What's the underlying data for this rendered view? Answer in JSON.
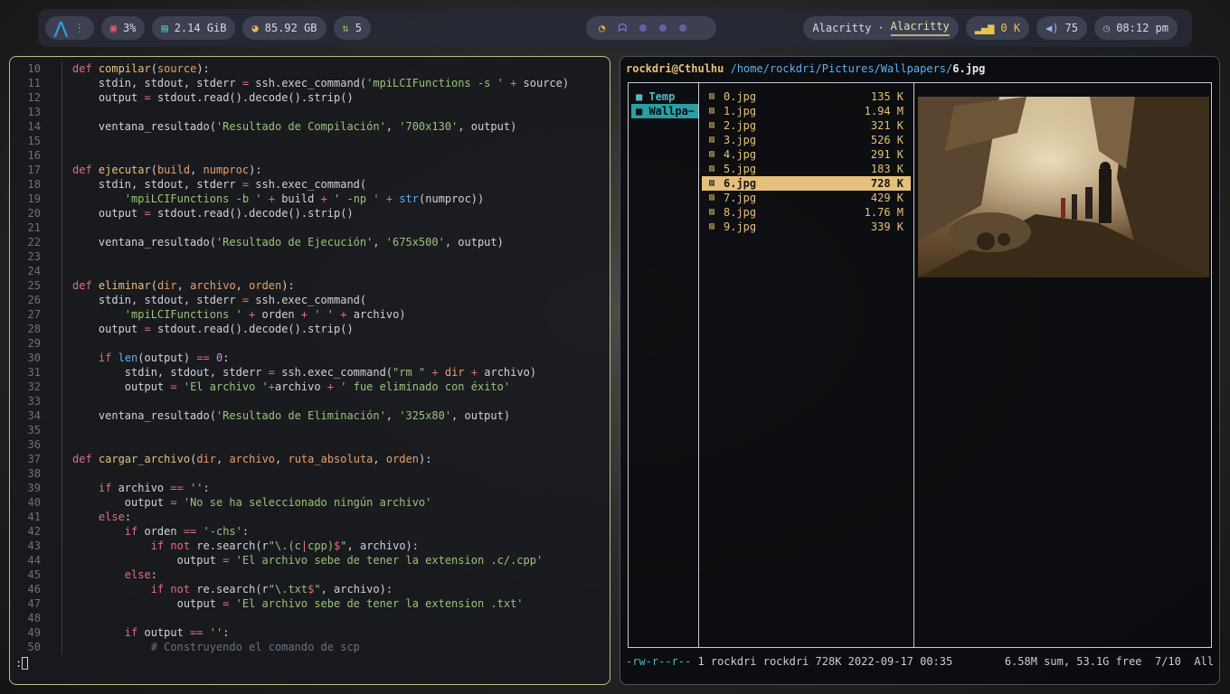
{
  "bar": {
    "cpu": "3%",
    "ram": "2.14 GiB",
    "disk": "85.92 GB",
    "updates": "5",
    "window_title_left": "Alacritty",
    "window_title_sep": "·",
    "window_title_right": "Alacritty",
    "net": "0 K",
    "volume": "75",
    "clock": "08:12 pm",
    "accent": "#2e9bd6"
  },
  "editor": {
    "lines": [
      {
        "n": "10",
        "h": "<span class=\"kw\">def</span> <span class=\"fn\">compilar</span>(<span class=\"prm\">source</span>):"
      },
      {
        "n": "11",
        "h": "    stdin, stdout, stderr <span class=\"op\">=</span> ssh.exec_command(<span class=\"str\">'mpiLCIFunctions -s '</span> <span class=\"op\">+</span> source)"
      },
      {
        "n": "12",
        "h": "    output <span class=\"op\">=</span> stdout.read().decode().strip()"
      },
      {
        "n": "13",
        "h": ""
      },
      {
        "n": "14",
        "h": "    ventana_resultado(<span class=\"str\">'Resultado de Compilación'</span>, <span class=\"str\">'700x130'</span>, output)"
      },
      {
        "n": "15",
        "h": ""
      },
      {
        "n": "16",
        "h": ""
      },
      {
        "n": "17",
        "h": "<span class=\"kw\">def</span> <span class=\"fn\">ejecutar</span>(<span class=\"prm\">build</span>, <span class=\"prm\">numproc</span>):"
      },
      {
        "n": "18",
        "h": "    stdin, stdout, stderr <span class=\"op\">=</span> ssh.exec_command("
      },
      {
        "n": "19",
        "h": "        <span class=\"str\">'mpiLCIFunctions -b '</span> <span class=\"op\">+</span> build <span class=\"op\">+</span> <span class=\"str\">' -np '</span> <span class=\"op\">+</span> <span class=\"bi\">str</span>(numproc))"
      },
      {
        "n": "20",
        "h": "    output <span class=\"op\">=</span> stdout.read().decode().strip()"
      },
      {
        "n": "21",
        "h": ""
      },
      {
        "n": "22",
        "h": "    ventana_resultado(<span class=\"str\">'Resultado de Ejecución'</span>, <span class=\"str\">'675x500'</span>, output)"
      },
      {
        "n": "23",
        "h": ""
      },
      {
        "n": "24",
        "h": ""
      },
      {
        "n": "25",
        "h": "<span class=\"kw\">def</span> <span class=\"fn\">eliminar</span>(<span class=\"prm\">dir</span>, <span class=\"prm\">archivo</span>, <span class=\"prm\">orden</span>):"
      },
      {
        "n": "26",
        "h": "    stdin, stdout, stderr <span class=\"op\">=</span> ssh.exec_command("
      },
      {
        "n": "27",
        "h": "        <span class=\"str\">'mpiLCIFunctions '</span> <span class=\"op\">+</span> orden <span class=\"op\">+</span> <span class=\"str\">' '</span> <span class=\"op\">+</span> archivo)"
      },
      {
        "n": "28",
        "h": "    output <span class=\"op\">=</span> stdout.read().decode().strip()"
      },
      {
        "n": "29",
        "h": ""
      },
      {
        "n": "30",
        "h": "    <span class=\"kw\">if</span> <span class=\"bi\">len</span>(output) <span class=\"op\">==</span> <span class=\"num\">0</span>:"
      },
      {
        "n": "31",
        "h": "        stdin, stdout, stderr <span class=\"op\">=</span> ssh.exec_command(<span class=\"str\">\"rm \"</span> <span class=\"op\">+</span> <span class=\"prm\">dir</span> <span class=\"op\">+</span> archivo)"
      },
      {
        "n": "32",
        "h": "        output <span class=\"op\">=</span> <span class=\"str\">'El archivo '</span><span class=\"op\">+</span>archivo <span class=\"op\">+</span> <span class=\"str\">' fue eliminado con éxito'</span>"
      },
      {
        "n": "33",
        "h": ""
      },
      {
        "n": "34",
        "h": "    ventana_resultado(<span class=\"str\">'Resultado de Eliminación'</span>, <span class=\"str\">'325x80'</span>, output)"
      },
      {
        "n": "35",
        "h": ""
      },
      {
        "n": "36",
        "h": ""
      },
      {
        "n": "37",
        "h": "<span class=\"kw\">def</span> <span class=\"fn\">cargar_archivo</span>(<span class=\"prm\">dir</span>, <span class=\"prm\">archivo</span>, <span class=\"prm\">ruta_absoluta</span>, <span class=\"prm\">orden</span>):"
      },
      {
        "n": "38",
        "h": ""
      },
      {
        "n": "39",
        "h": "    <span class=\"kw\">if</span> archivo <span class=\"op\">==</span> <span class=\"str\">''</span>:"
      },
      {
        "n": "40",
        "h": "        output <span class=\"op\">=</span> <span class=\"str\">'No se ha seleccionado ningún archivo'</span>"
      },
      {
        "n": "41",
        "h": "    <span class=\"kw\">else</span>:"
      },
      {
        "n": "42",
        "h": "        <span class=\"kw\">if</span> orden <span class=\"op\">==</span> <span class=\"str\">'-chs'</span>:"
      },
      {
        "n": "43",
        "h": "            <span class=\"kw\">if</span> <span class=\"kw\">not</span> re.search(r<span class=\"str\">\"\\.(c<span class=\"op\">|</span>cpp)<span class=\"op\">$</span>\"</span>, archivo):"
      },
      {
        "n": "44",
        "h": "                output <span class=\"op\">=</span> <span class=\"str\">'El archivo sebe de tener la extension .c/.cpp'</span>"
      },
      {
        "n": "45",
        "h": "        <span class=\"kw\">else</span>:"
      },
      {
        "n": "46",
        "h": "            <span class=\"kw\">if</span> <span class=\"kw\">not</span> re.search(r<span class=\"str\">\"\\.txt<span class=\"op\">$</span>\"</span>, archivo):"
      },
      {
        "n": "47",
        "h": "                output <span class=\"op\">=</span> <span class=\"str\">'El archivo sebe de tener la extension .txt'</span>"
      },
      {
        "n": "48",
        "h": ""
      },
      {
        "n": "49",
        "h": "        <span class=\"kw\">if</span> output <span class=\"op\">==</span> <span class=\"str\">''</span>:"
      },
      {
        "n": "50",
        "h": "            <span class=\"cmt\"># Construyendo el comando de scp</span>"
      }
    ],
    "cmdline": ":"
  },
  "fm": {
    "user_host": "rockdri@Cthulhu",
    "path": "/home/rockdri/Pictures/Wallpapers/",
    "file": "6.jpg",
    "dirs": [
      {
        "name": "Temp",
        "selected": false
      },
      {
        "name": "Wallpa~",
        "selected": true
      }
    ],
    "files": [
      {
        "name": "0.jpg",
        "size": "135 K"
      },
      {
        "name": "1.jpg",
        "size": "1.94 M"
      },
      {
        "name": "2.jpg",
        "size": "321 K"
      },
      {
        "name": "3.jpg",
        "size": "526 K"
      },
      {
        "name": "4.jpg",
        "size": "291 K"
      },
      {
        "name": "5.jpg",
        "size": "183 K"
      },
      {
        "name": "6.jpg",
        "size": "728 K",
        "selected": true
      },
      {
        "name": "7.jpg",
        "size": "429 K"
      },
      {
        "name": "8.jpg",
        "size": "1.76 M"
      },
      {
        "name": "9.jpg",
        "size": "339 K"
      }
    ],
    "status_perm": "-rw-r--r--",
    "status_meta": " 1 rockdri rockdri 728K 2022-09-17 00:35",
    "status_right": "6.58M sum, 53.1G free  7/10  All"
  }
}
